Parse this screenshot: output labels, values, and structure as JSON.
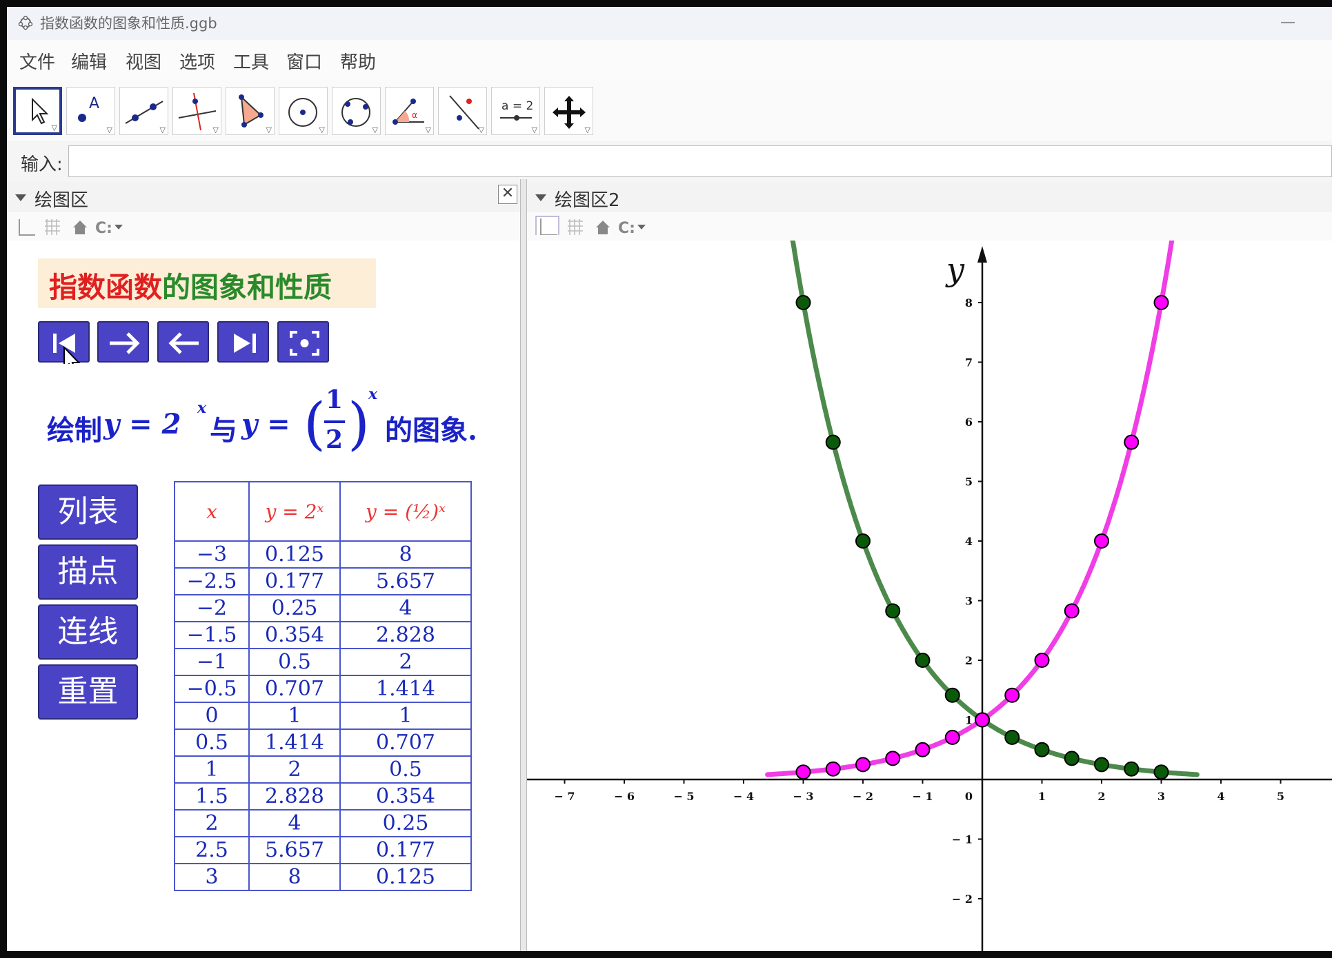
{
  "window": {
    "title": "指数函数的图象和性质.ggb"
  },
  "menu": {
    "items": [
      "文件",
      "编辑",
      "视图",
      "选项",
      "工具",
      "窗口",
      "帮助"
    ]
  },
  "toolbar": {
    "tools": [
      "move-tool-icon",
      "point-tool-icon",
      "line-tool-icon",
      "perpendicular-tool-icon",
      "polygon-tool-icon",
      "circle-tool-icon",
      "conic-tool-icon",
      "angle-tool-icon",
      "reflect-tool-icon",
      "slider-tool-icon",
      "move-view-tool-icon"
    ],
    "slider_label": "a = 2"
  },
  "input_bar": {
    "label": "输入:",
    "value": "",
    "placeholder": ""
  },
  "graphics1": {
    "title": "绘图区",
    "heading_red": "指数函数",
    "heading_green": "的图象和性质",
    "formula": {
      "prefix": "绘制",
      "eq1": "y = 2",
      "exp1": "x",
      "mid": "与",
      "eq2": "y =",
      "num": "1",
      "den": "2",
      "exp2": "x",
      "suffix": "的图象."
    },
    "buttons": [
      "列表",
      "描点",
      "连线",
      "重置"
    ],
    "table": {
      "headers": [
        "x",
        "y = 2ˣ",
        "y = (½)ˣ"
      ],
      "rows": [
        [
          "−3",
          "0.125",
          "8"
        ],
        [
          "−2.5",
          "0.177",
          "5.657"
        ],
        [
          "−2",
          "0.25",
          "4"
        ],
        [
          "−1.5",
          "0.354",
          "2.828"
        ],
        [
          "−1",
          "0.5",
          "2"
        ],
        [
          "−0.5",
          "0.707",
          "1.414"
        ],
        [
          "0",
          "1",
          "1"
        ],
        [
          "0.5",
          "1.414",
          "0.707"
        ],
        [
          "1",
          "2",
          "0.5"
        ],
        [
          "1.5",
          "2.828",
          "0.354"
        ],
        [
          "2",
          "4",
          "0.25"
        ],
        [
          "2.5",
          "5.657",
          "0.177"
        ],
        [
          "3",
          "8",
          "0.125"
        ]
      ]
    }
  },
  "graphics2": {
    "title": "绘图区2",
    "axis_name": "y"
  },
  "colors": {
    "pink": "#f03ee6",
    "green": "#4c8a4c",
    "point_pink": "#ff00ff",
    "point_green": "#0a5a0a",
    "button": "#4b43c6"
  },
  "chart_data": {
    "type": "line",
    "xlim": [
      -7.5,
      6
    ],
    "ylim": [
      -2.6,
      9
    ],
    "x_ticks": [
      -7,
      -6,
      -5,
      -4,
      -3,
      -2,
      -1,
      1,
      2,
      3,
      4,
      5
    ],
    "y_ticks": [
      -2,
      -1,
      1,
      2,
      3,
      4,
      5,
      6,
      7,
      8
    ],
    "x_tick_labels": [
      "− 7",
      "− 6",
      "− 5",
      "− 4",
      "− 3",
      "− 2",
      "− 1",
      "1",
      "2",
      "3",
      "4",
      "5"
    ],
    "y_tick_labels": [
      "− 2",
      "− 1",
      "1",
      "2",
      "3",
      "4",
      "5",
      "6",
      "7",
      "8"
    ],
    "origin_label": "0",
    "series": [
      {
        "function": "2^x",
        "color": "#f03ee6",
        "points_x": [
          -3,
          -2.5,
          -2,
          -1.5,
          -1,
          -0.5,
          0,
          0.5,
          1,
          1.5,
          2,
          2.5,
          3
        ],
        "points_y": [
          0.125,
          0.177,
          0.25,
          0.354,
          0.5,
          0.707,
          1,
          1.414,
          2,
          2.828,
          4,
          5.657,
          8
        ]
      },
      {
        "function": "(1/2)^x",
        "color": "#4c8a4c",
        "points_x": [
          -3,
          -2.5,
          -2,
          -1.5,
          -1,
          -0.5,
          0,
          0.5,
          1,
          1.5,
          2,
          2.5,
          3
        ],
        "points_y": [
          8,
          5.657,
          4,
          2.828,
          2,
          1.414,
          1,
          0.707,
          0.5,
          0.354,
          0.25,
          0.177,
          0.125
        ]
      }
    ]
  }
}
